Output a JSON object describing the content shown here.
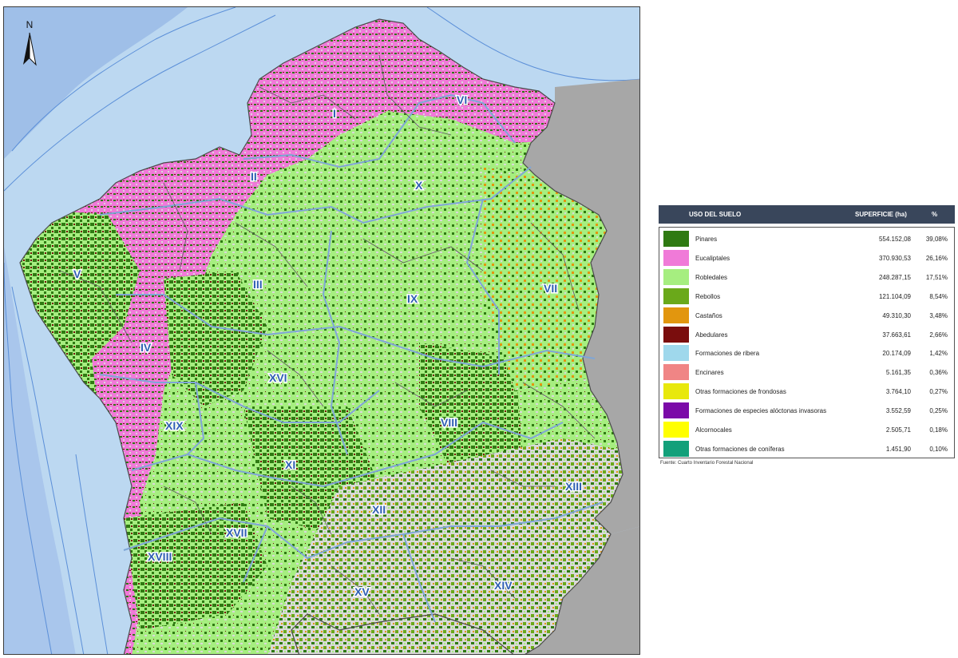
{
  "map": {
    "north_label": "N",
    "regions": [
      {
        "label": "I"
      },
      {
        "label": "II"
      },
      {
        "label": "III"
      },
      {
        "label": "IV"
      },
      {
        "label": "V"
      },
      {
        "label": "VI"
      },
      {
        "label": "VII"
      },
      {
        "label": "VIII"
      },
      {
        "label": "IX"
      },
      {
        "label": "X"
      },
      {
        "label": "XI"
      },
      {
        "label": "XII"
      },
      {
        "label": "XIII"
      },
      {
        "label": "XIV"
      },
      {
        "label": "XV"
      },
      {
        "label": "XVI"
      },
      {
        "label": "XVII"
      },
      {
        "label": "XVIII"
      },
      {
        "label": "XIX"
      }
    ],
    "colors": {
      "sea": "#bcd8f1",
      "deep_sea": "#9fbfe8",
      "land_outside": "#a7a7a7",
      "land_bare": "#d9d9d9",
      "boundary": "#5a5a5a",
      "region_boundary": "#7fa6d6"
    }
  },
  "legend": {
    "header": {
      "uso": "USO DEL SUELO",
      "superficie": "SUPERFICIE (ha)",
      "pct": "%"
    },
    "rows": [
      {
        "name": "Pinares",
        "area": "554.152,08",
        "pct": "39,08%",
        "color": "#2f7a12"
      },
      {
        "name": "Eucaliptales",
        "area": "370.930,53",
        "pct": "26,16%",
        "color": "#f07ad8"
      },
      {
        "name": "Robledales",
        "area": "248.287,15",
        "pct": "17,51%",
        "color": "#a6ee80"
      },
      {
        "name": "Rebollos",
        "area": "121.104,09",
        "pct": "8,54%",
        "color": "#6aa91a"
      },
      {
        "name": "Castaños",
        "area": "49.310,30",
        "pct": "3,48%",
        "color": "#e2960e"
      },
      {
        "name": "Abedulares",
        "area": "37.663,61",
        "pct": "2,66%",
        "color": "#7a0d0d"
      },
      {
        "name": "Formaciones de ribera",
        "area": "20.174,09",
        "pct": "1,42%",
        "color": "#9fd8ec"
      },
      {
        "name": "Encinares",
        "area": "5.161,35",
        "pct": "0,36%",
        "color": "#f08585"
      },
      {
        "name": "Otras formaciones de frondosas",
        "area": "3.764,10",
        "pct": "0,27%",
        "color": "#e8e80c"
      },
      {
        "name": "Formaciones de especies alóctonas invasoras",
        "area": "3.552,59",
        "pct": "0,25%",
        "color": "#7b0aa8"
      },
      {
        "name": "Alcornocales",
        "area": "2.505,71",
        "pct": "0,18%",
        "color": "#ffff00"
      },
      {
        "name": "Otras formaciones de coníferas",
        "area": "1.451,90",
        "pct": "0,10%",
        "color": "#13a07a"
      }
    ],
    "source": "Fuente: Cuarto Inventario Forestal Nacional"
  }
}
